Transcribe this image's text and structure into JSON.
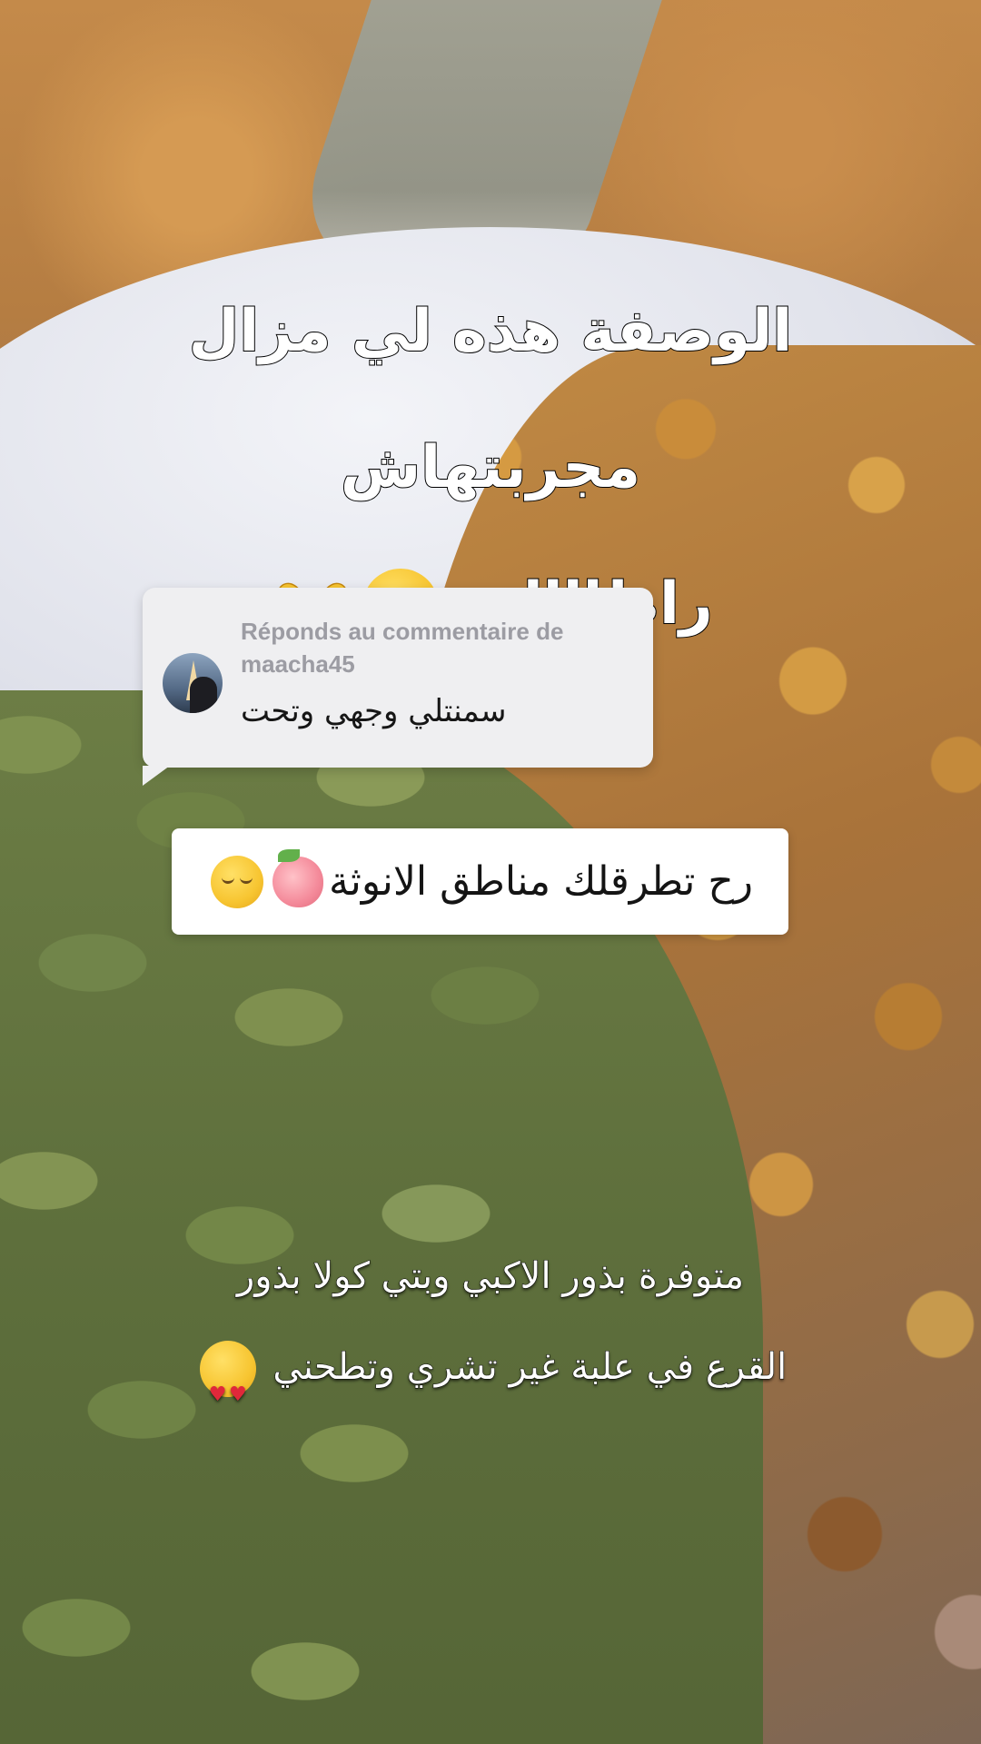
{
  "caption_top": {
    "line1": "الوصفة هذه لي مزال مجربتهاش",
    "line2": "راطاااات",
    "emojis": [
      "pleading-face-icon",
      "heart-hands-icon"
    ]
  },
  "reply": {
    "header": "Réponds au commentaire de",
    "username": "maacha45",
    "comment": "سمنتلي وجهي وتحت"
  },
  "label": {
    "text": "رح تطرقلك مناطق الانوثة",
    "emojis": [
      "peach-icon",
      "relieved-face-icon"
    ]
  },
  "caption_bottom": {
    "line1": "متوفرة بذور الاكبي وبتي كولا بذور",
    "line2": "القرع في علبة غير تشري وتطحني",
    "emojis": [
      "heart-eyes-icon"
    ]
  },
  "colors": {
    "caption_fill": "#ffffff",
    "caption_stroke": "#000000",
    "reply_bg": "#efeff1",
    "reply_meta": "#9c9ca3",
    "label_bg": "#ffffff"
  }
}
